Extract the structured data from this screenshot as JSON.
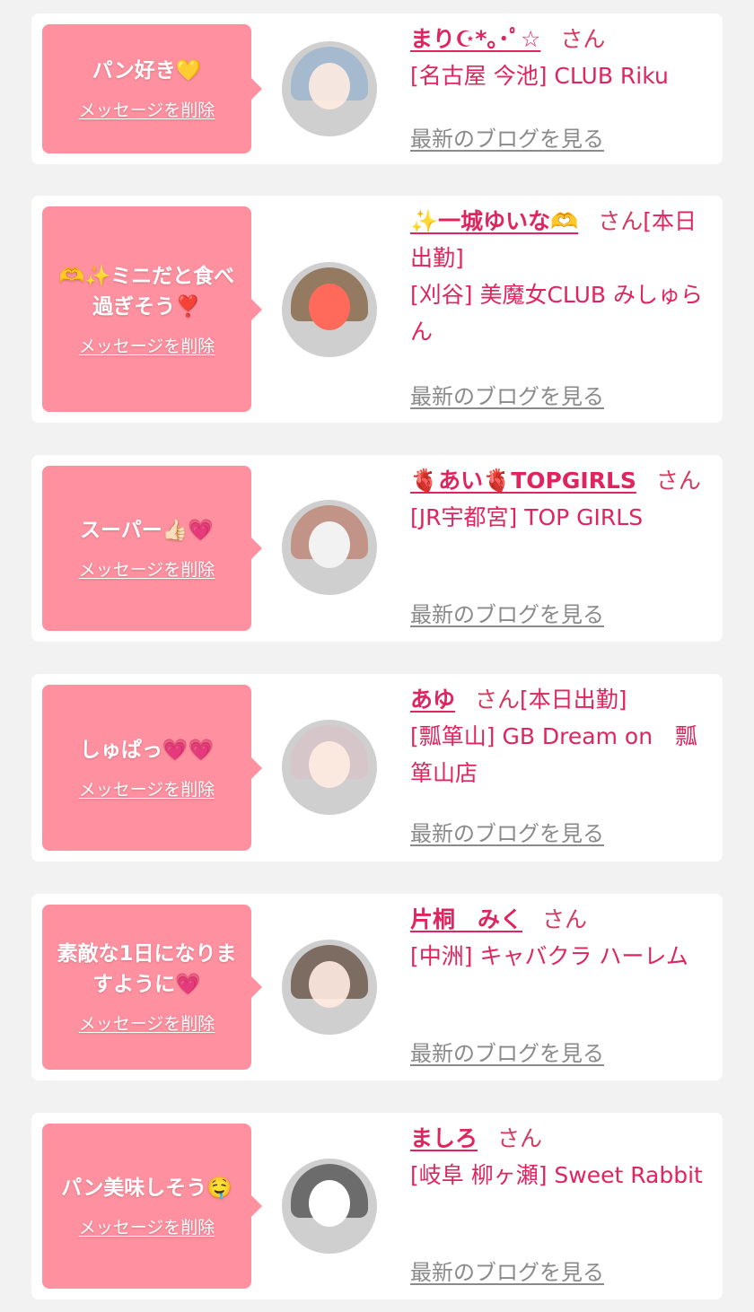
{
  "favorites": [
    {
      "message": "パン好き💛",
      "delete_label": "メッセージを削除",
      "name": "まり☪︎*｡･ﾟ☆",
      "honorific": "さん",
      "status": "",
      "shop": "[名古屋 今池] CLUB Riku",
      "blog_label": "最新のブログを見る",
      "avatar_icon": "avatar-photo",
      "avatar_tone": "#9fb6cf"
    },
    {
      "message": "🫶✨ミニだと食べ過ぎそう❣️",
      "delete_label": "メッセージを削除",
      "name": "✨一城ゆいな🫶",
      "honorific": "さん",
      "status": "[本日出勤]",
      "shop": "[刈谷] 美魔女CLUB みしゅらん",
      "blog_label": "最新のブログを見る",
      "avatar_icon": "avatar-photo",
      "avatar_tone": "#8b6b4f"
    },
    {
      "message": "スーパー👍🏻💗",
      "delete_label": "メッセージを削除",
      "name": "🫀あい🫀TOPGIRLS",
      "honorific": "さん",
      "status": "",
      "shop": "[JR宇都宮] TOP GIRLS",
      "blog_label": "最新のブログを見る",
      "avatar_icon": "avatar-photo",
      "avatar_tone": "#c08a7a"
    },
    {
      "message": "しゅぱっ💗💗",
      "delete_label": "メッセージを削除",
      "name": "あゆ",
      "honorific": "さん",
      "status": "[本日出勤]",
      "shop": "[瓢箪山] GB Dream on　瓢箪山店",
      "blog_label": "最新のブログを見る",
      "avatar_icon": "avatar-photo",
      "avatar_tone": "#d7c4c9"
    },
    {
      "message": "素敵な1日になりますように💗",
      "delete_label": "メッセージを削除",
      "name": "片桐　みく",
      "honorific": "さん",
      "status": "",
      "shop": "[中洲] キャバクラ ハーレム",
      "blog_label": "最新のブログを見る",
      "avatar_icon": "avatar-photo",
      "avatar_tone": "#6f5a4f"
    },
    {
      "message": "パン美味しそう🤤",
      "delete_label": "メッセージを削除",
      "name": "ましろ",
      "honorific": "さん",
      "status": "",
      "shop": "[岐阜 柳ヶ瀬] Sweet Rabbit",
      "blog_label": "最新のブログを見る",
      "avatar_icon": "avatar-photo",
      "avatar_tone": "#5a5a5a"
    }
  ]
}
